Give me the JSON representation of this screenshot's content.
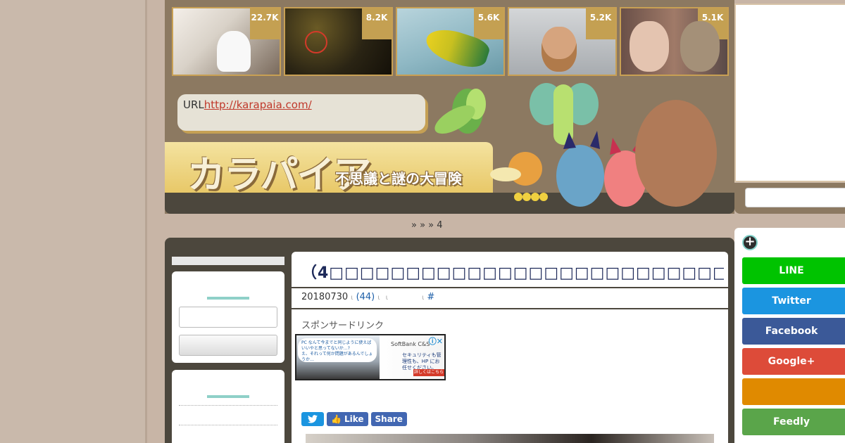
{
  "popular": [
    {
      "count": "22.7K"
    },
    {
      "count": "8.2K"
    },
    {
      "count": "5.6K"
    },
    {
      "count": "5.2K"
    },
    {
      "count": "5.1K"
    }
  ],
  "url_box": {
    "label": "URL",
    "link": "http://karapaia.com/"
  },
  "logo": {
    "main": "カラパイア",
    "sub": "不思議と謎の大冒険"
  },
  "breadcrumb": "»   »          » 4",
  "article": {
    "title": "（4□□□□□□□□□□□□□□□□□□□□□□□□□□□□□□□□□□",
    "date": "20180730",
    "comments": "(44)",
    "tag": "#",
    "sponsor": "スポンサードリンク",
    "ad": {
      "bubble": "PC なんて今までと同じように使えばいいやと思ってないか…?",
      "bubble2": "え、それって何か問題があるんでしょうか…",
      "brand": "SoftBank C&S",
      "text": "セキュリティも管理性も、HP にお任せください。",
      "cta": "詳しくはこちら",
      "close": "ⓘ✕"
    },
    "share": {
      "like": "Like",
      "share": "Share"
    }
  },
  "share_panel": [
    {
      "label": "LINE",
      "color": "#00c300"
    },
    {
      "label": "Twitter",
      "color": "#1b95e0"
    },
    {
      "label": "Facebook",
      "color": "#3b5998"
    },
    {
      "label": "Google+",
      "color": "#dd4b39"
    },
    {
      "label": "",
      "color": "#e08a00"
    },
    {
      "label": "Feedly",
      "color": "#5aa54a"
    }
  ]
}
